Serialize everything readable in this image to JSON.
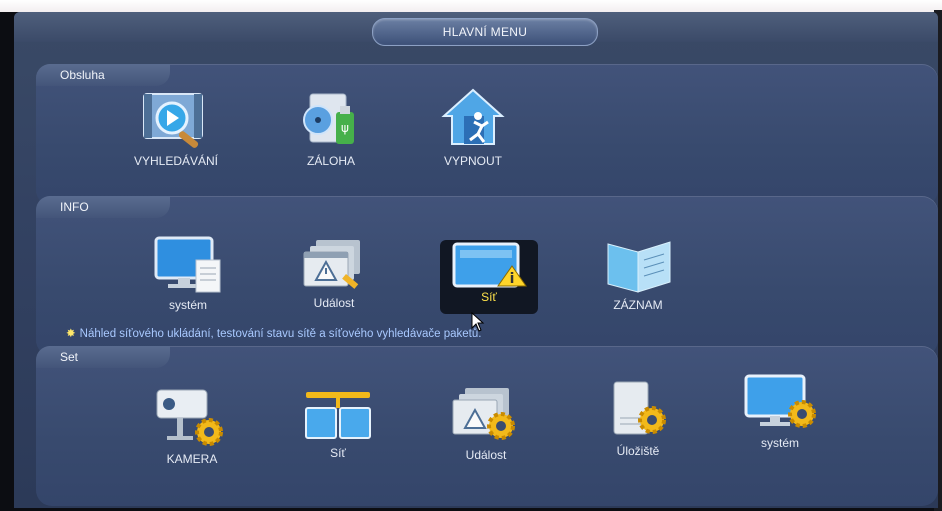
{
  "title": "HLAVNÍ MENU",
  "sections": {
    "obsluha": {
      "label": "Obsluha",
      "items": [
        {
          "label": "VYHLEDÁVÁNÍ",
          "icon": "search-video-icon"
        },
        {
          "label": "ZÁLOHA",
          "icon": "backup-usb-icon"
        },
        {
          "label": "VYPNOUT",
          "icon": "exit-house-icon"
        }
      ]
    },
    "info": {
      "label": "INFO",
      "items": [
        {
          "label": "systém",
          "icon": "monitor-document-icon"
        },
        {
          "label": "Událost",
          "icon": "event-warning-icon"
        },
        {
          "label": "Síť",
          "icon": "network-info-icon",
          "selected": true
        },
        {
          "label": "ZÁZNAM",
          "icon": "log-book-icon"
        }
      ],
      "hint": "Náhled síťového ukládání,  testování stavu sítě a síťového vyhledávače paketů."
    },
    "set": {
      "label": "Set",
      "items": [
        {
          "label": "KAMERA",
          "icon": "camera-gear-icon"
        },
        {
          "label": "Síť",
          "icon": "network-gear-icon"
        },
        {
          "label": "Událost",
          "icon": "event-gear-icon"
        },
        {
          "label": "Úložiště",
          "icon": "storage-gear-icon"
        },
        {
          "label": "systém",
          "icon": "system-gear-icon"
        }
      ]
    }
  },
  "colors": {
    "panel": "#3a4c70",
    "accent_selected": "#ffe34a",
    "hint_text": "#a9c9ff"
  }
}
